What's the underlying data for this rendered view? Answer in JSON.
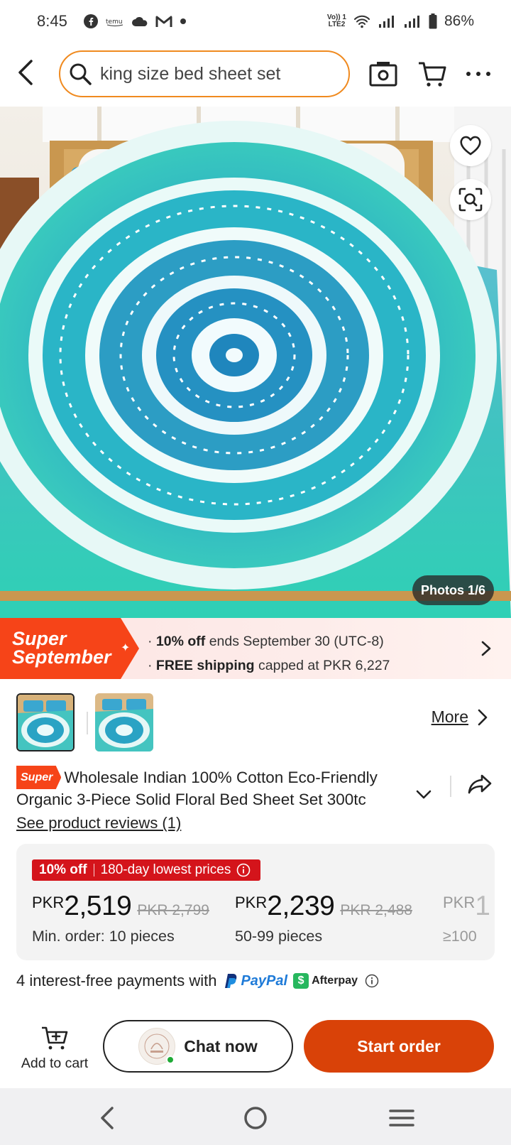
{
  "status_bar": {
    "time": "8:45",
    "battery": "86%",
    "network": "LTE2",
    "volte": "Vo)) 1"
  },
  "search": {
    "value": "king size bed sheet set",
    "placeholder": "king size bed sheet set"
  },
  "hero": {
    "photo_counter": "Photos 1/6"
  },
  "promo": {
    "badge_line1": "Super",
    "badge_line2": "September",
    "line1_bold": "10% off",
    "line1_rest": " ends September 30 (UTC-8)",
    "line2_bold": "FREE shipping",
    "line2_rest": " capped at PKR 6,227"
  },
  "thumbnails": {
    "more_label": "More"
  },
  "product": {
    "super_tag": "Super",
    "title": "Wholesale Indian 100% Cotton Eco-Friendly Organic 3-Piece Solid Floral Bed Sheet Set 300tc",
    "reviews_link": "See product reviews (1)"
  },
  "pricing": {
    "badge_discount": "10% off",
    "badge_text": "180-day lowest prices",
    "tiers": [
      {
        "currency": "PKR",
        "price": "2,519",
        "original": "PKR 2,799",
        "quantity": "Min. order: 10 pieces"
      },
      {
        "currency": "PKR",
        "price": "2,239",
        "original": "PKR 2,488",
        "quantity": "50-99 pieces"
      },
      {
        "currency": "PKR",
        "price": "1",
        "original": "",
        "quantity": "≥100"
      }
    ]
  },
  "payment": {
    "text": "4 interest-free payments with",
    "paypal": "PayPal",
    "afterpay": "Afterpay"
  },
  "actions": {
    "add_to_cart": "Add to cart",
    "chat": "Chat now",
    "start_order": "Start order"
  },
  "colors": {
    "accent": "#f64418",
    "start_order": "#d94208",
    "discount_red": "#d4141b",
    "search_border": "#f08a1f"
  }
}
